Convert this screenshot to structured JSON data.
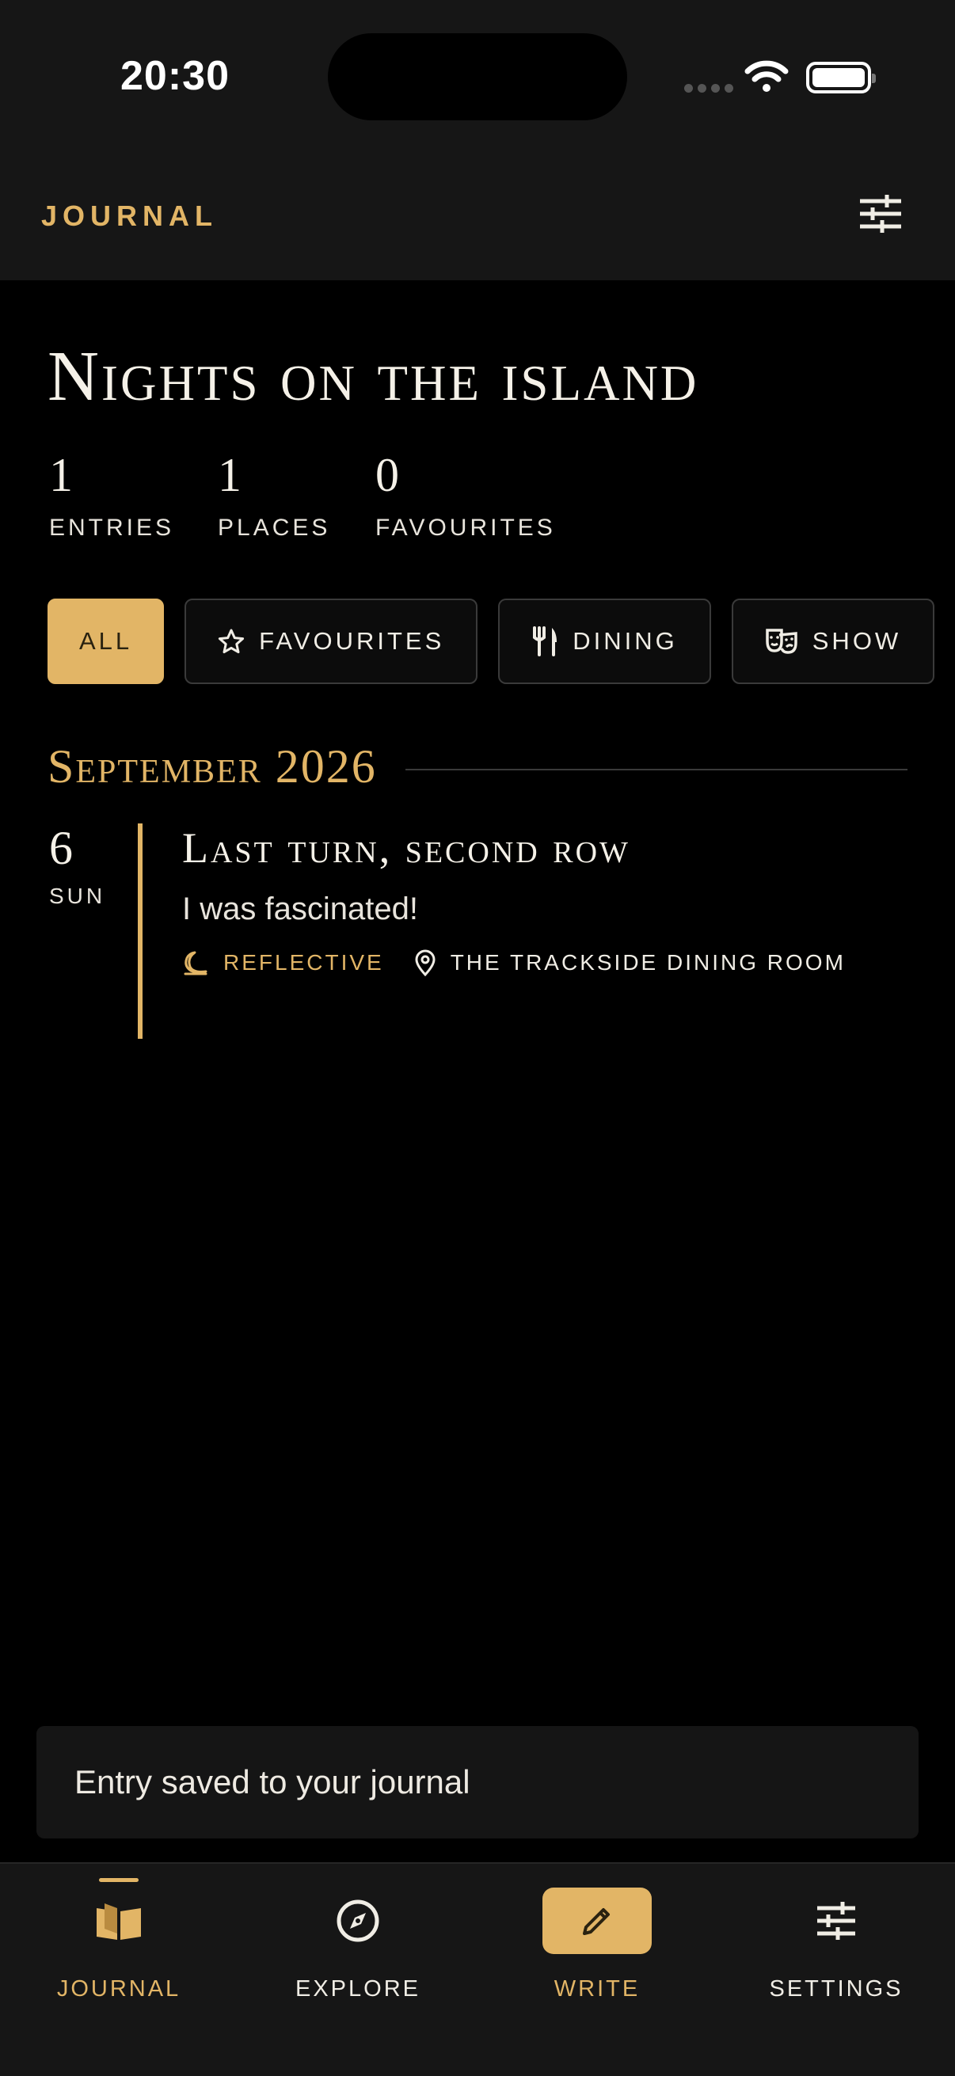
{
  "status_bar": {
    "time": "20:30"
  },
  "header": {
    "app_title": "JOURNAL",
    "filter_icon": "sliders-icon"
  },
  "page": {
    "title": "Nights on the island"
  },
  "stats": [
    {
      "value": "1",
      "label": "ENTRIES"
    },
    {
      "value": "1",
      "label": "PLACES"
    },
    {
      "value": "0",
      "label": "FAVOURITES"
    }
  ],
  "chips": [
    {
      "label": "ALL",
      "active": true
    },
    {
      "label": "FAVOURITES",
      "icon": "star-icon"
    },
    {
      "label": "DINING",
      "icon": "fork-knife-icon"
    },
    {
      "label": "SHOW",
      "icon": "theater-masks-icon"
    }
  ],
  "month": {
    "label": "September 2026"
  },
  "entry": {
    "day": "6",
    "weekday": "SUN",
    "title": "Last turn, second row",
    "excerpt": "I was fascinated!",
    "mood": "REFLECTIVE",
    "place": "THE TRACKSIDE DINING ROOM"
  },
  "toast": {
    "message": "Entry saved to your journal"
  },
  "tabs": [
    {
      "label": "JOURNAL",
      "icon": "book-icon",
      "active": true
    },
    {
      "label": "EXPLORE",
      "icon": "compass-icon"
    },
    {
      "label": "WRITE",
      "icon": "pencil-icon"
    },
    {
      "label": "SETTINGS",
      "icon": "sliders-icon"
    }
  ],
  "colors": {
    "accent": "#e2b566",
    "background": "#000000",
    "surface": "#161616"
  }
}
